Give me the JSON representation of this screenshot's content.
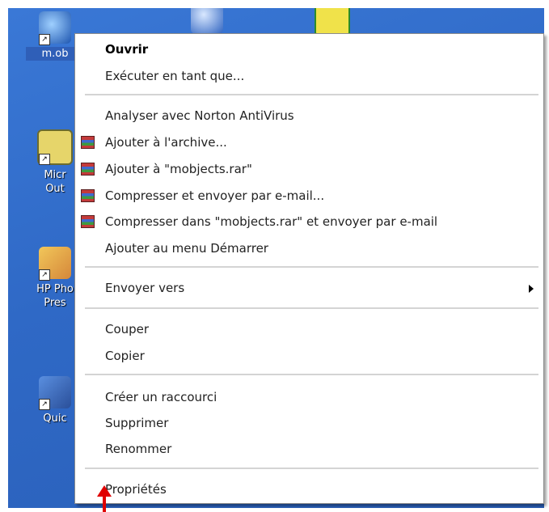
{
  "desktop": {
    "icons": [
      {
        "id": "m-objects",
        "label": "m.ob",
        "selected": true
      },
      {
        "id": "micro",
        "label_line1": "Micr",
        "label_line2": "Out"
      },
      {
        "id": "hp-photo",
        "label_line1": "HP Pho",
        "label_line2": "Pres"
      },
      {
        "id": "quick",
        "label": "Quic"
      }
    ]
  },
  "context_menu": {
    "items": [
      {
        "key": "open",
        "label": "Ouvrir",
        "bold": true
      },
      {
        "key": "run-as",
        "label": "Exécuter en tant que..."
      },
      {
        "key": "norton",
        "label": "Analyser avec Norton AntiVirus"
      },
      {
        "key": "add-archive",
        "label": "Ajouter à l'archive...",
        "icon": "winrar-icon"
      },
      {
        "key": "add-mobjects-rar",
        "label": "Ajouter à \"mobjects.rar\"",
        "icon": "winrar-icon"
      },
      {
        "key": "compress-email",
        "label": "Compresser et envoyer par e-mail...",
        "icon": "winrar-icon"
      },
      {
        "key": "compress-rar-email",
        "label": "Compresser dans \"mobjects.rar\" et envoyer par e-mail",
        "icon": "winrar-icon"
      },
      {
        "key": "add-start-menu",
        "label": "Ajouter au menu Démarrer"
      },
      {
        "key": "send-to",
        "label": "Envoyer vers",
        "submenu": true
      },
      {
        "key": "cut",
        "label": "Couper"
      },
      {
        "key": "copy",
        "label": "Copier"
      },
      {
        "key": "create-shortcut",
        "label": "Créer un raccourci"
      },
      {
        "key": "delete",
        "label": "Supprimer"
      },
      {
        "key": "rename",
        "label": "Renommer"
      },
      {
        "key": "properties",
        "label": "Propriétés"
      }
    ]
  },
  "colors": {
    "desktop": "#2f69c6",
    "menu_background": "#ffffff",
    "separator": "#d4d4d4",
    "pointer_arrow": "#e00000"
  }
}
